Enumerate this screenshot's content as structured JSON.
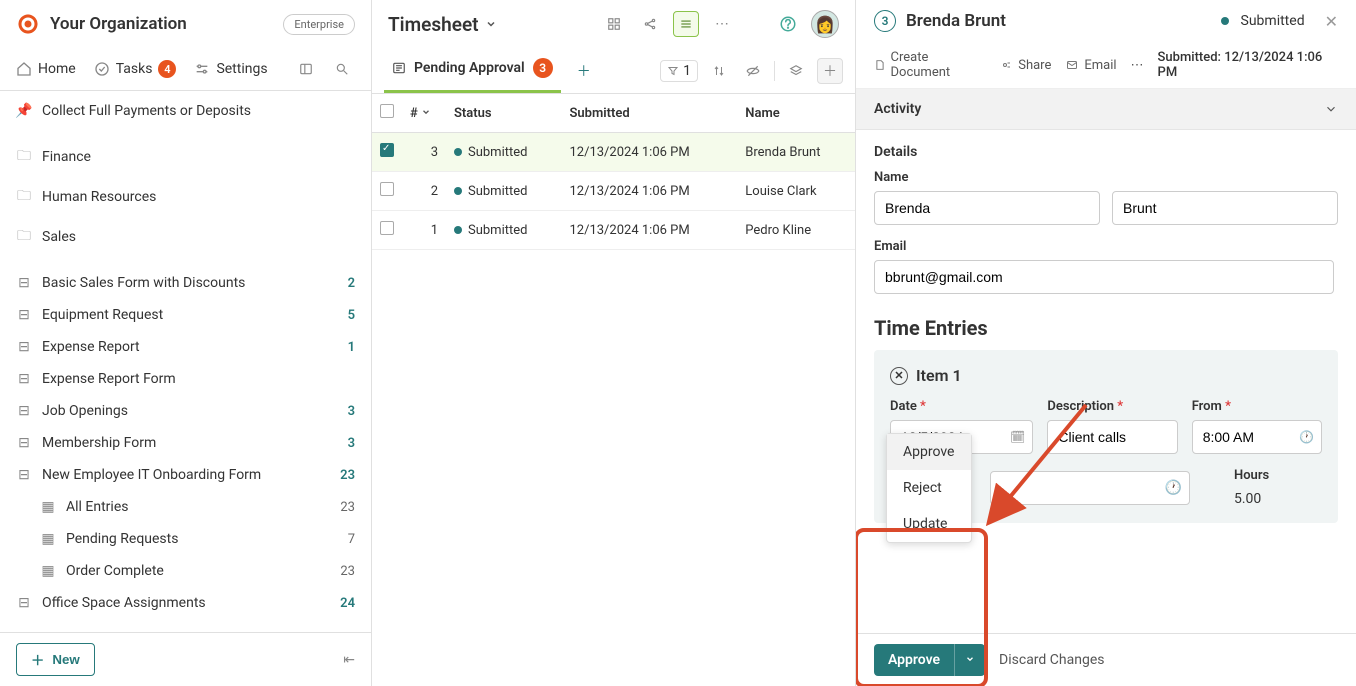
{
  "org": {
    "name": "Your Organization",
    "plan": "Enterprise"
  },
  "nav": {
    "home": "Home",
    "tasks": "Tasks",
    "tasks_count": "4",
    "settings": "Settings"
  },
  "pinned": {
    "collect": "Collect Full Payments or Deposits"
  },
  "folders": {
    "finance": "Finance",
    "hr": "Human Resources",
    "sales": "Sales"
  },
  "apps": {
    "basic_sales": {
      "label": "Basic Sales Form with Discounts",
      "count": "2"
    },
    "equipment": {
      "label": "Equipment Request",
      "count": "5"
    },
    "expense_report": {
      "label": "Expense Report",
      "count": "1"
    },
    "expense_form": {
      "label": "Expense Report Form",
      "count": ""
    },
    "job": {
      "label": "Job Openings",
      "count": "3"
    },
    "membership": {
      "label": "Membership Form",
      "count": "3"
    },
    "onboarding": {
      "label": "New Employee IT Onboarding Form",
      "count": "23"
    },
    "office": {
      "label": "Office Space Assignments",
      "count": "24"
    }
  },
  "subitems": {
    "all_entries": {
      "label": "All Entries",
      "count": "23"
    },
    "pending_req": {
      "label": "Pending Requests",
      "count": "7"
    },
    "order_complete": {
      "label": "Order Complete",
      "count": "23"
    }
  },
  "new_btn": "New",
  "center": {
    "title": "Timesheet",
    "tab_label": "Pending Approval",
    "tab_count": "3",
    "filter_count": "1",
    "columns": {
      "num": "#",
      "status": "Status",
      "submitted": "Submitted",
      "name": "Name"
    },
    "rows": [
      {
        "num": "3",
        "status": "Submitted",
        "submitted": "12/13/2024 1:06 PM",
        "name": "Brenda Brunt"
      },
      {
        "num": "2",
        "status": "Submitted",
        "submitted": "12/13/2024 1:06 PM",
        "name": "Louise Clark"
      },
      {
        "num": "1",
        "status": "Submitted",
        "submitted": "12/13/2024 1:06 PM",
        "name": "Pedro Kline"
      }
    ]
  },
  "detail": {
    "num": "3",
    "title": "Brenda Brunt",
    "status": "Submitted",
    "actions": {
      "create_doc": "Create Document",
      "share": "Share",
      "email": "Email"
    },
    "submitted_prefix": "Submitted: ",
    "submitted_value": "12/13/2024 1:06 PM",
    "activity": "Activity",
    "details": "Details",
    "name_label": "Name",
    "first": "Brenda",
    "last": "Brunt",
    "email_label": "Email",
    "email": "bbrunt@gmail.com",
    "entries_title": "Time Entries",
    "item1": {
      "label": "Item 1",
      "date_label": "Date",
      "date": "12/5/2024",
      "desc_label": "Description",
      "desc": "Client calls",
      "from_label": "From",
      "from": "8:00 AM",
      "hours_label": "Hours",
      "hours": "5.00"
    },
    "menu": {
      "approve": "Approve",
      "reject": "Reject",
      "update": "Update"
    },
    "approve_btn": "Approve",
    "discard": "Discard Changes"
  }
}
